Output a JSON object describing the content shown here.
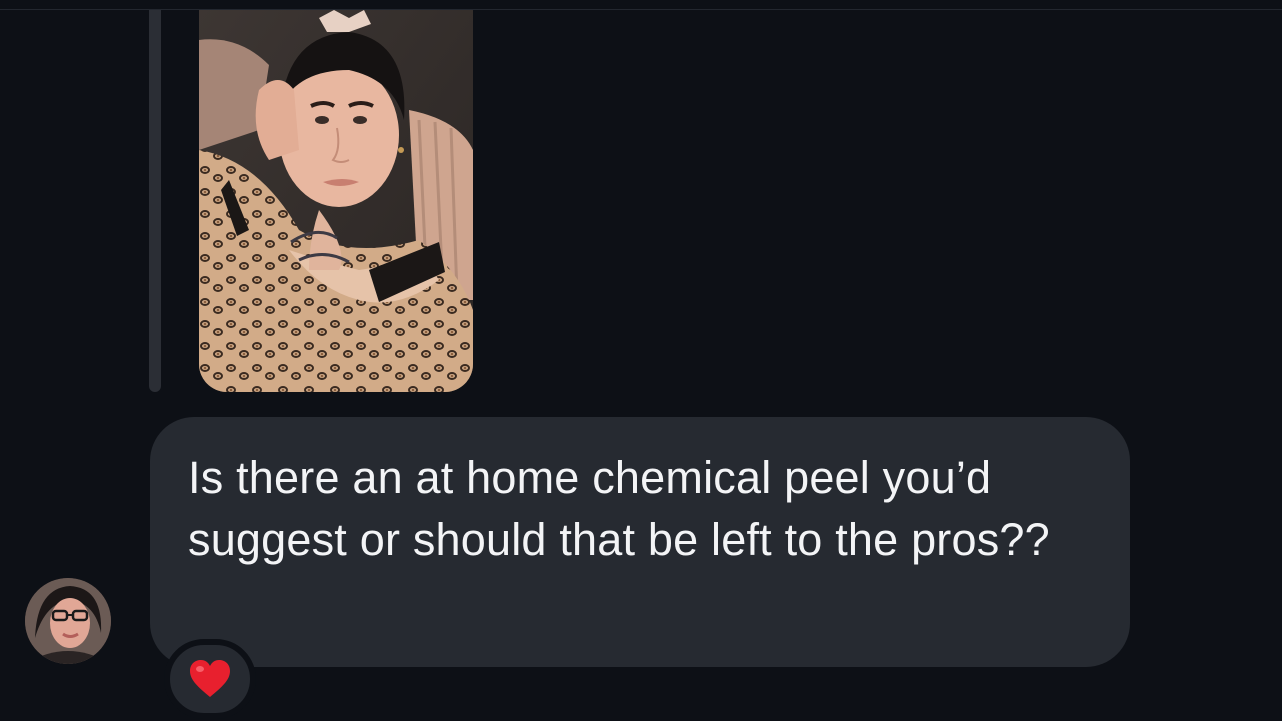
{
  "conversation": {
    "shared_photo": {
      "icon": "photo-of-person-in-leopard-print-pajamas"
    },
    "message": {
      "text": "Is there an at home chemical peel you’d suggest or should that be left to the pros??"
    },
    "sender": {
      "avatar_icon": "profile-photo-avatar"
    },
    "reaction": {
      "icon": "red-heart-icon",
      "color": "#e8202e"
    }
  },
  "theme": {
    "background": "#0d1016",
    "bubble": "#262a31",
    "text": "#f3f4f6"
  }
}
